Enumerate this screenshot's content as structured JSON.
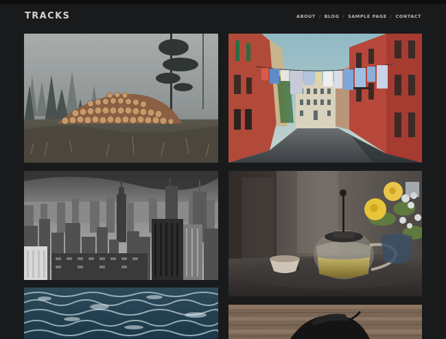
{
  "site": {
    "title": "TRACKS"
  },
  "nav": {
    "items": [
      {
        "label": "ABOUT"
      },
      {
        "label": "BLOG"
      },
      {
        "label": "SAMPLE PAGE"
      },
      {
        "label": "CONTACT"
      }
    ],
    "separator": "/"
  },
  "gallery": {
    "tiles": [
      {
        "icon": "foggy-forest-log-pile-photo"
      },
      {
        "icon": "italian-street-laundry-photo"
      },
      {
        "icon": "city-skyline-black-white-photo"
      },
      {
        "icon": "teapot-and-flowers-photo"
      },
      {
        "icon": "ocean-waves-photo"
      },
      {
        "icon": "black-hat-on-wood-photo"
      }
    ]
  },
  "colors": {
    "background": "#191a1b",
    "title": "#d2d2d2",
    "nav": "#bdbdbd"
  }
}
